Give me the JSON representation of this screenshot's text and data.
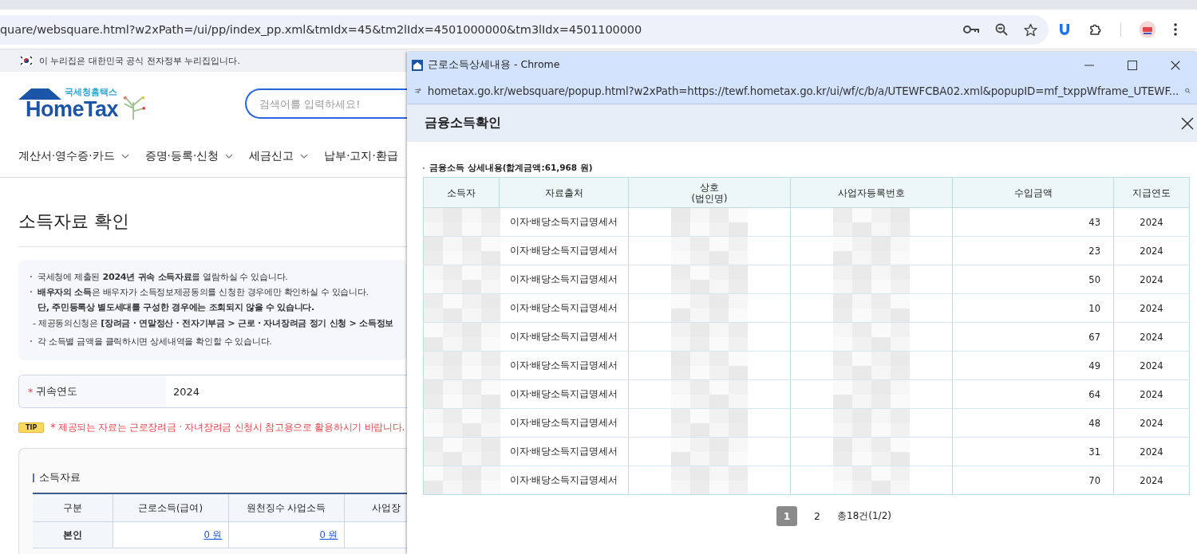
{
  "browser": {
    "url": "quare/websquare.html?w2xPath=/ui/pp/index_pp.xml&tmIdx=45&tm2lIdx=4501000000&tm3lIdx=4501100000"
  },
  "gov_banner": "이 누리집은 대한민국 공식 전자정부 누리집입니다.",
  "logo": {
    "subtitle": "국세청홈택스",
    "name": "HomeTax"
  },
  "search": {
    "placeholder": "검색어를 입력하세요!"
  },
  "nav": [
    {
      "label": "계산서·영수증·카드",
      "dropdown": true
    },
    {
      "label": "증명·등록·신청",
      "dropdown": true
    },
    {
      "label": "세금신고",
      "dropdown": true
    },
    {
      "label": "납부·고지·환급",
      "dropdown": false
    }
  ],
  "page_title": "소득자료 확인",
  "notices": [
    {
      "kind": "bullet",
      "text": "국세청에 제출된 **2024년 귀속 소득자료**를 열람하실 수 있습니다."
    },
    {
      "kind": "bullet",
      "text": "**배우자의 소득**은 배우자가 소득정보제공동의를 신청한 경우에만 확인하실 수 있습니다."
    },
    {
      "kind": "strong",
      "text": "단, 주민등록상 별도세대를 구성한 경우에는 조회되지 않을 수 있습니다."
    },
    {
      "kind": "sub",
      "text": "- 제공동의신청은 **[장려금 · 연말정산 · 전자기부금 > 근로 · 자녀장려금 정기 신청 > 소득정보**"
    },
    {
      "kind": "bullet",
      "text": "각 소득별 금액을 클릭하시면 상세내역을 확인할 수 있습니다."
    }
  ],
  "year_field": {
    "required_mark": "*",
    "label": "귀속연도",
    "value": "2024"
  },
  "tip": {
    "badge": "TIP",
    "text": "* 제공되는 자료는 근로장려금 · 자녀장려금 신청시 참고용으로 활용하시기 바랍니다."
  },
  "income_section": {
    "title": "소득자료",
    "columns": [
      "구분",
      "근로소득(급여)",
      "원천징수 사업소득",
      "사업장"
    ],
    "rows": [
      {
        "cells": [
          "본인",
          "0 원",
          "0 원"
        ]
      }
    ]
  },
  "popup": {
    "window_title": "근로소득상세내용 - Chrome",
    "url": "hometax.go.kr/websquare/popup.html?w2xPath=https://tewf.hometax.go.kr/ui/wf/c/b/a/UTEWFCBA02.xml&popupID=mf_txppWframe_UTEWF...",
    "dialog_title": "금융소득확인",
    "summary": "금융소득 상세내용(합계금액:61,968 원)",
    "columns": [
      "소득자",
      "자료출처",
      "상호\n(법인명)",
      "사업자등록번호",
      "수입금액",
      "지급연도"
    ],
    "rows": [
      {
        "source": "이자·배당소득지급명세서",
        "amount": "43",
        "year": "2024",
        "redacted": true
      },
      {
        "source": "이자·배당소득지급명세서",
        "amount": "23",
        "year": "2024",
        "redacted": true
      },
      {
        "source": "이자·배당소득지급명세서",
        "amount": "50",
        "year": "2024",
        "redacted": true
      },
      {
        "source": "이자·배당소득지급명세서",
        "amount": "10",
        "year": "2024",
        "redacted": true
      },
      {
        "source": "이자·배당소득지급명세서",
        "amount": "67",
        "year": "2024",
        "redacted": true
      },
      {
        "source": "이자·배당소득지급명세서",
        "amount": "49",
        "year": "2024",
        "redacted": true
      },
      {
        "source": "이자·배당소득지급명세서",
        "amount": "64",
        "year": "2024",
        "redacted": true
      },
      {
        "source": "이자·배당소득지급명세서",
        "amount": "48",
        "year": "2024",
        "redacted": true
      },
      {
        "source": "이자·배당소득지급명세서",
        "amount": "31",
        "year": "2024",
        "redacted": true
      },
      {
        "source": "이자·배당소득지급명세서",
        "amount": "70",
        "year": "2024",
        "redacted": true
      }
    ],
    "pagination": {
      "pages": [
        {
          "label": "1",
          "selected": true
        },
        {
          "label": "2",
          "selected": false
        }
      ],
      "total": "총18건(1/2)"
    }
  }
}
